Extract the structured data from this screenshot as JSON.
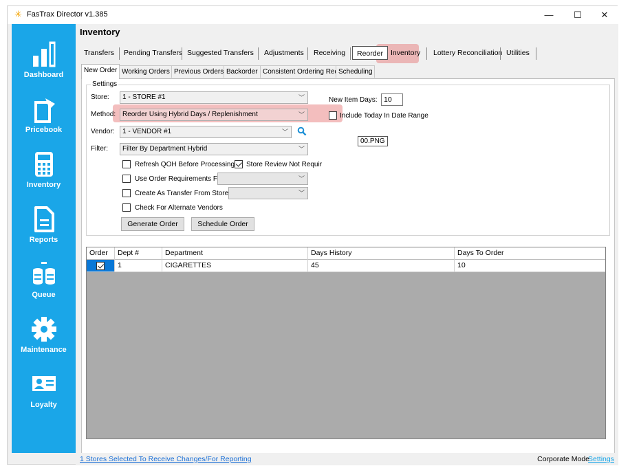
{
  "window": {
    "title": "FasTrax Director v1.385",
    "controls": {
      "minimize": "—",
      "maximize": "☐",
      "close": "✕"
    }
  },
  "sidebar": {
    "items": [
      {
        "label": "Dashboard",
        "icon": "bar-chart-icon"
      },
      {
        "label": "Pricebook",
        "icon": "tag-icon"
      },
      {
        "label": "Inventory",
        "icon": "calculator-icon"
      },
      {
        "label": "Reports",
        "icon": "document-icon"
      },
      {
        "label": "Queue",
        "icon": "database-icon"
      },
      {
        "label": "Maintenance",
        "icon": "gear-icon"
      },
      {
        "label": "Loyalty",
        "icon": "id-card-icon"
      }
    ]
  },
  "page": {
    "title": "Inventory"
  },
  "top_tabs": [
    "Transfers",
    "Pending Transfers",
    "Suggested Transfers",
    "Adjustments",
    "Receiving",
    "Reorder",
    "Inventory",
    "Lottery Reconciliation",
    "Utilities"
  ],
  "sub_tabs": [
    "New Order",
    "Working Orders",
    "Previous Orders",
    "Backorder",
    "Consistent Ordering Req",
    "Scheduling"
  ],
  "settings": {
    "legend": "Settings",
    "store_label": "Store:",
    "store_value": "1 - STORE #1",
    "method_label": "Method:",
    "method_value": "Reorder Using Hybrid Days / Replenishment",
    "vendor_label": "Vendor:",
    "vendor_value": "1 - VENDOR #1",
    "filter_label": "Filter:",
    "filter_value": "Filter By Department Hybrid",
    "new_item_days_label": "New Item Days:",
    "new_item_days_value": "10",
    "include_today_label": "Include Today In Date Range",
    "refresh_qoh_label": "Refresh QOH Before Processing",
    "store_review_label": "Store Review Not Requir",
    "use_order_req_label": "Use Order Requirements From:",
    "create_transfer_label": "Create As Transfer From Store:",
    "check_alt_vendors_label": "Check For Alternate Vendors",
    "generate_button": "Generate Order",
    "schedule_button": "Schedule Order"
  },
  "tooltip": "00.PNG",
  "grid": {
    "columns": [
      "Order",
      "Dept #",
      "Department",
      "Days History",
      "Days To Order"
    ],
    "rows": [
      {
        "order_checked": true,
        "dept": "1",
        "department": "CIGARETTES",
        "days_history": "45",
        "days_to_order": "10"
      }
    ]
  },
  "status": {
    "stores_link": "1 Stores Selected To Receive Changes/For Reporting",
    "mode": "Corporate Mode",
    "settings_link": "Settings"
  },
  "colors": {
    "sidebar": "#1aa6e8",
    "highlight": "#e56e6e",
    "selection": "#0a78d7"
  }
}
